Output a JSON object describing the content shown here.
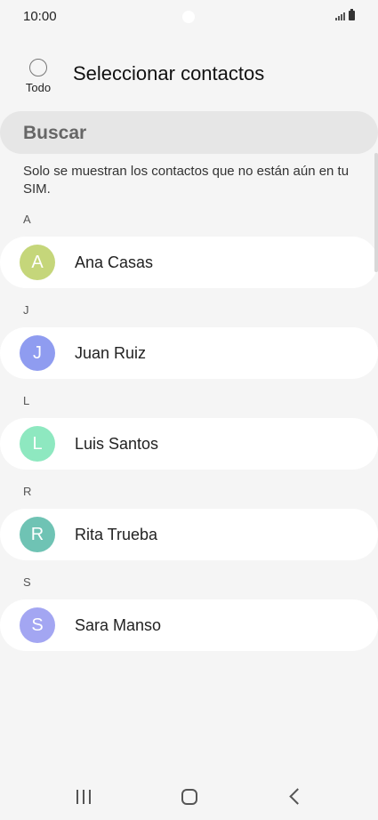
{
  "status": {
    "time": "10:00"
  },
  "header": {
    "select_all_label": "Todo",
    "title": "Seleccionar contactos"
  },
  "search": {
    "label": "Buscar"
  },
  "info_text": "Solo se muestran los contactos que no están aún en tu SIM.",
  "sections": [
    {
      "letter": "A",
      "contact": {
        "initial": "A",
        "name": "Ana Casas",
        "color": "#c5d67a"
      }
    },
    {
      "letter": "J",
      "contact": {
        "initial": "J",
        "name": "Juan Ruiz",
        "color": "#8f9cf0"
      }
    },
    {
      "letter": "L",
      "contact": {
        "initial": "L",
        "name": "Luis Santos",
        "color": "#8ee8c0"
      }
    },
    {
      "letter": "R",
      "contact": {
        "initial": "R",
        "name": "Rita Trueba",
        "color": "#6fc3b4"
      }
    },
    {
      "letter": "S",
      "contact": {
        "initial": "S",
        "name": "Sara Manso",
        "color": "#a3a6f2"
      }
    }
  ],
  "icons": {
    "signal": "signal-icon",
    "battery": "battery-icon",
    "recent_apps": "recent-apps-icon",
    "home": "home-icon",
    "back": "back-icon"
  }
}
